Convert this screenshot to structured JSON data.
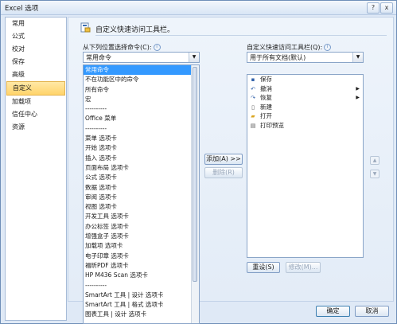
{
  "window": {
    "title": "Excel 选项"
  },
  "nav": {
    "items": [
      {
        "label": "常用"
      },
      {
        "label": "公式"
      },
      {
        "label": "校对"
      },
      {
        "label": "保存"
      },
      {
        "label": "高级"
      },
      {
        "label": "自定义",
        "selected": true
      },
      {
        "label": "加载项"
      },
      {
        "label": "信任中心"
      },
      {
        "label": "资源"
      }
    ]
  },
  "content": {
    "heading": "自定义快速访问工具栏。",
    "choose_label": "从下列位置选择命令(C):",
    "choose_value": "常用命令",
    "qat_label": "自定义快速访问工具栏(Q):",
    "qat_value": "用于所有文档(默认)"
  },
  "commands": [
    "常用命令",
    "不在功能区中的命令",
    "所有命令",
    "宏",
    "----------",
    "Office 菜单",
    "----------",
    "菜单 选项卡",
    "开始 选项卡",
    "插入 选项卡",
    "页面布局 选项卡",
    "公式 选项卡",
    "数据 选项卡",
    "审阅 选项卡",
    "视图 选项卡",
    "开发工具 选项卡",
    "办公标签 选项卡",
    "增强盒子 选项卡",
    "加载项 选项卡",
    "电子印章 选项卡",
    "福昕PDF 选项卡",
    "HP M436 Scan 选项卡",
    "----------",
    "SmartArt 工具 | 设计 选项卡",
    "SmartArt 工具 | 格式 选项卡",
    "图表工具 | 设计 选项卡"
  ],
  "qat_items": [
    {
      "label": "保存",
      "icon": "save-icon",
      "glyph": "▪",
      "color": "#2f5fa8"
    },
    {
      "label": "撤消",
      "icon": "undo-icon",
      "glyph": "↶",
      "color": "#2f5fa8",
      "submenu": true
    },
    {
      "label": "恢复",
      "icon": "redo-icon",
      "glyph": "↷",
      "color": "#2f5fa8",
      "submenu": true
    },
    {
      "label": "新建",
      "icon": "new-document-icon",
      "glyph": "▯",
      "color": "#555555"
    },
    {
      "label": "打开",
      "icon": "open-folder-icon",
      "glyph": "▰",
      "color": "#d9a520"
    },
    {
      "label": "打印预览",
      "icon": "print-preview-icon",
      "glyph": "▤",
      "color": "#555555"
    }
  ],
  "buttons": {
    "add": "添加(A) >>",
    "remove": "删除(R)",
    "reset": "重设(S)",
    "modify": "修改(M)...",
    "ok": "确定",
    "cancel": "取消",
    "help": "?",
    "close": "x"
  },
  "colors": {
    "selection": "#3399ff",
    "nav_selected": "#ffd46b"
  }
}
